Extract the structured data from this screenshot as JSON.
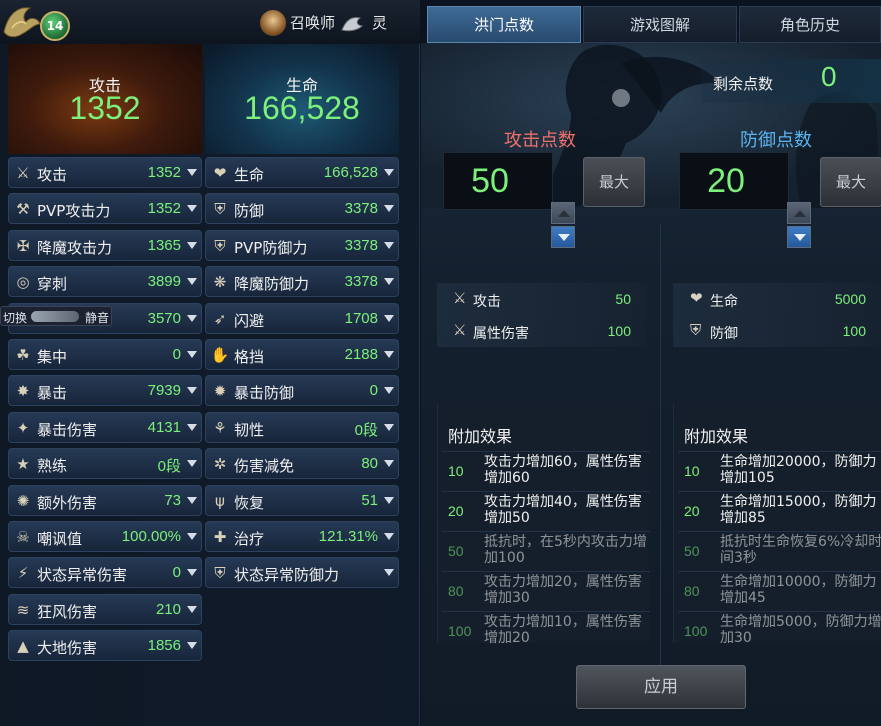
{
  "header": {
    "level": "14",
    "summoner_label": "召唤师",
    "spirit_label": "灵"
  },
  "summary": {
    "attack_label": "攻击",
    "attack_value": "1352",
    "life_label": "生命",
    "life_value": "166,528"
  },
  "left_stats": [
    {
      "icon": "swords-icon",
      "glyph": "⚔",
      "label": "攻击",
      "value": "1352"
    },
    {
      "icon": "pvp-attack-icon",
      "glyph": "⚒",
      "label": "PVP攻击力",
      "value": "1352"
    },
    {
      "icon": "demon-attack-icon",
      "glyph": "✠",
      "label": "降魔攻击力",
      "value": "1365"
    },
    {
      "icon": "pierce-icon",
      "glyph": "◎",
      "label": "穿刺",
      "value": "3899"
    },
    {
      "icon": "speaker-icon",
      "glyph": "♪",
      "label": "",
      "value": "3570"
    },
    {
      "icon": "focus-icon",
      "glyph": "☘",
      "label": "集中",
      "value": "0"
    },
    {
      "icon": "crit-icon",
      "glyph": "✸",
      "label": "暴击",
      "value": "7939"
    },
    {
      "icon": "crit-damage-icon",
      "glyph": "✦",
      "label": "暴击伤害",
      "value": "4131"
    },
    {
      "icon": "mastery-icon",
      "glyph": "★",
      "label": "熟练",
      "value": "0段"
    },
    {
      "icon": "extra-damage-icon",
      "glyph": "✺",
      "label": "额外伤害",
      "value": "73"
    },
    {
      "icon": "skull-icon",
      "glyph": "☠",
      "label": "嘲讽值",
      "value": "100.00%"
    },
    {
      "icon": "status-attack-icon",
      "glyph": "⚡",
      "label": "状态异常伤害",
      "value": "0"
    },
    {
      "icon": "wind-icon",
      "glyph": "≋",
      "label": "狂风伤害",
      "value": "210"
    },
    {
      "icon": "earth-icon",
      "glyph": "▲",
      "label": "大地伤害",
      "value": "1856"
    }
  ],
  "right_stats": [
    {
      "icon": "heart-icon",
      "glyph": "❤",
      "label": "生命",
      "value": "166,528"
    },
    {
      "icon": "shield-icon",
      "glyph": "⛨",
      "label": "防御",
      "value": "3378"
    },
    {
      "icon": "pvp-defense-icon",
      "glyph": "⛨",
      "label": "PVP防御力",
      "value": "3378"
    },
    {
      "icon": "demon-defense-icon",
      "glyph": "❋",
      "label": "降魔防御力",
      "value": "3378"
    },
    {
      "icon": "evade-icon",
      "glyph": "➶",
      "label": "闪避",
      "value": "1708"
    },
    {
      "icon": "block-icon",
      "glyph": "✋",
      "label": "格挡",
      "value": "2188"
    },
    {
      "icon": "crit-defense-icon",
      "glyph": "✹",
      "label": "暴击防御",
      "value": "0"
    },
    {
      "icon": "toughness-icon",
      "glyph": "⚘",
      "label": "韧性",
      "value": "0段"
    },
    {
      "icon": "damage-reduce-icon",
      "glyph": "✲",
      "label": "伤害减免",
      "value": "80"
    },
    {
      "icon": "recovery-icon",
      "glyph": "ψ",
      "label": "恢复",
      "value": "51"
    },
    {
      "icon": "heal-icon",
      "glyph": "✚",
      "label": "治疗",
      "value": "121.31%"
    },
    {
      "icon": "status-defense-icon",
      "glyph": "⛨",
      "label": "状态异常防御力",
      "value": ""
    }
  ],
  "voice_chip": {
    "left": "切换",
    "right": "静音"
  },
  "tabs": [
    {
      "label": "洪门点数",
      "active": true
    },
    {
      "label": "游戏图解",
      "active": false
    },
    {
      "label": "角色历史",
      "active": false
    }
  ],
  "points": {
    "remaining_label": "剩余点数",
    "remaining_value": "0",
    "attack_title": "攻击点数",
    "attack_value": "50",
    "defense_title": "防御点数",
    "defense_value": "20",
    "max_label": "最大",
    "attack_title_color": "#f0706a",
    "defense_title_color": "#5ab4f0"
  },
  "attack_attrs": [
    {
      "icon": "swords-icon",
      "label": "攻击",
      "value": "50"
    },
    {
      "icon": "element-damage-icon",
      "label": "属性伤害",
      "value": "100"
    }
  ],
  "defense_attrs": [
    {
      "icon": "heart-icon",
      "label": "生命",
      "value": "5000"
    },
    {
      "icon": "shield-icon",
      "label": "防御",
      "value": "100"
    }
  ],
  "attack_effects": {
    "title": "附加效果",
    "rows": [
      {
        "level": "10",
        "desc": "攻击力增加60，属性伤害增加60"
      },
      {
        "level": "20",
        "desc": "攻击力增加40，属性伤害增加50"
      },
      {
        "level": "50",
        "desc": "抵抗时，在5秒内攻击力增加100"
      },
      {
        "level": "80",
        "desc": "攻击力增加20，属性伤害增加30"
      },
      {
        "level": "100",
        "desc": "攻击力增加10，属性伤害增加20"
      }
    ]
  },
  "defense_effects": {
    "title": "附加效果",
    "rows": [
      {
        "level": "10",
        "desc": "生命增加20000，防御力增加105"
      },
      {
        "level": "20",
        "desc": "生命增加15000，防御力增加85"
      },
      {
        "level": "50",
        "desc": "抵抗时生命恢复6%冷却时间3秒"
      },
      {
        "level": "80",
        "desc": "生命增加10000，防御力增加45"
      },
      {
        "level": "100",
        "desc": "生命增加5000，防御力增加30"
      }
    ]
  },
  "apply_label": "应用"
}
